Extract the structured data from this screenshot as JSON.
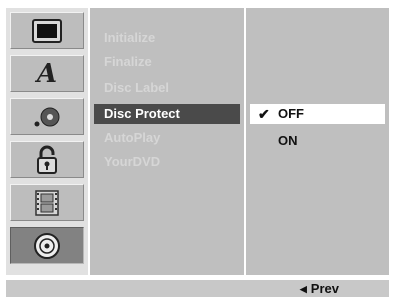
{
  "icon_sidebar": {
    "items": [
      {
        "icon": "tv-icon",
        "active": false
      },
      {
        "icon": "language-icon",
        "label": "A",
        "active": false
      },
      {
        "icon": "audio-icon",
        "active": false
      },
      {
        "icon": "lock-icon",
        "active": false
      },
      {
        "icon": "film-icon",
        "active": false
      },
      {
        "icon": "disc-icon",
        "active": true
      }
    ]
  },
  "menu": {
    "items": [
      {
        "label": "Initialize",
        "state": "disabled"
      },
      {
        "label": "Finalize",
        "state": "disabled"
      },
      {
        "label": "Disc Label",
        "state": "disabled"
      },
      {
        "label": "Disc Protect",
        "state": "selected"
      },
      {
        "label": "AutoPlay",
        "state": "disabled"
      },
      {
        "label": "YourDVD",
        "state": "disabled"
      }
    ]
  },
  "options": {
    "items": [
      {
        "label": "OFF",
        "checked": true,
        "highlighted": true
      },
      {
        "label": "ON",
        "checked": false,
        "highlighted": false
      }
    ],
    "check_glyph": "✔"
  },
  "footer": {
    "prev_arrow": "◀",
    "prev_label": "Prev"
  },
  "colors": {
    "panel": "#bfbfbf",
    "selected_menu": "#4a4a4a",
    "active_tile": "#828282"
  }
}
